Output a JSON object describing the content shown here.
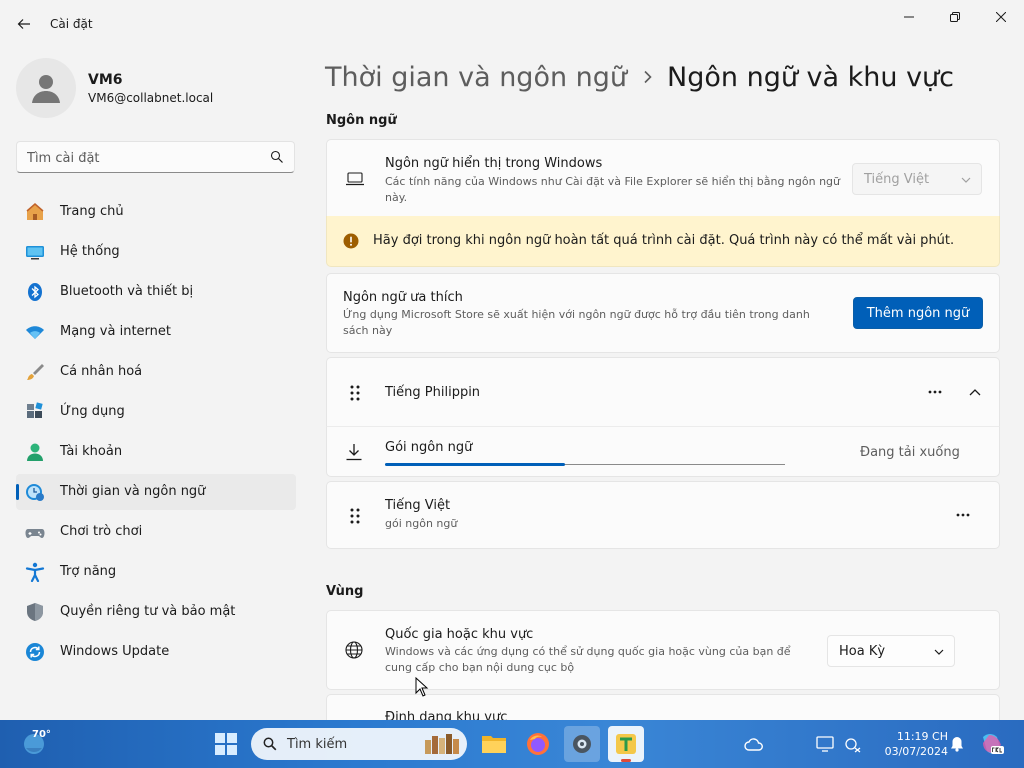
{
  "window": {
    "title": "Cài đặt"
  },
  "user": {
    "name": "VM6",
    "email": "VM6@collabnet.local"
  },
  "search": {
    "placeholder": "Tìm cài đặt"
  },
  "nav": {
    "items": [
      {
        "label": "Trang chủ",
        "icon": "home-icon"
      },
      {
        "label": "Hệ thống",
        "icon": "system-icon"
      },
      {
        "label": "Bluetooth và thiết bị",
        "icon": "bluetooth-icon"
      },
      {
        "label": "Mạng và internet",
        "icon": "wifi-icon"
      },
      {
        "label": "Cá nhân hoá",
        "icon": "brush-icon"
      },
      {
        "label": "Ứng dụng",
        "icon": "apps-icon"
      },
      {
        "label": "Tài khoản",
        "icon": "account-icon"
      },
      {
        "label": "Thời gian và ngôn ngữ",
        "icon": "time-language-icon",
        "active": true
      },
      {
        "label": "Chơi trò chơi",
        "icon": "gamepad-icon"
      },
      {
        "label": "Trợ năng",
        "icon": "accessibility-icon"
      },
      {
        "label": "Quyền riêng tư và bảo mật",
        "icon": "shield-icon"
      },
      {
        "label": "Windows Update",
        "icon": "update-icon"
      }
    ]
  },
  "breadcrumb": {
    "parent": "Thời gian và ngôn ngữ",
    "current": "Ngôn ngữ và khu vực"
  },
  "language_section": {
    "title": "Ngôn ngữ",
    "display_language": {
      "title": "Ngôn ngữ hiển thị trong Windows",
      "desc_line1": "Các tính năng của Windows như Cài đặt và File Explorer sẽ hiển thị bằng ngôn ngữ",
      "desc_line2": "này.",
      "value": "Tiếng Việt"
    },
    "warning": "Hãy đợi trong khi ngôn ngữ hoàn tất quá trình cài đặt. Quá trình này có thể mất vài phút.",
    "preferred": {
      "title": "Ngôn ngữ ưa thích",
      "desc_line1": "Ứng dụng Microsoft Store sẽ xuất hiện với ngôn ngữ được hỗ trợ đầu tiên trong danh",
      "desc_line2": "sách này",
      "add_button": "Thêm ngôn ngữ"
    },
    "languages": [
      {
        "name": "Tiếng Philippin",
        "expanded": true,
        "pack_label": "Gói ngôn ngữ",
        "pack_status": "Đang tải xuống",
        "progress": 0.45
      },
      {
        "name": "Tiếng Việt",
        "subtitle": "gói ngôn ngữ"
      }
    ]
  },
  "region_section": {
    "title": "Vùng",
    "country": {
      "title": "Quốc gia hoặc khu vực",
      "desc_line1": "Windows và các ứng dụng có thể sử dụng quốc gia hoặc vùng của bạn để",
      "desc_line2": "cung cấp cho bạn nội dung cục bộ",
      "value": "Hoa Kỳ"
    },
    "format": {
      "title": "Định dạng khu vực"
    }
  },
  "taskbar": {
    "weather_temp": "70°",
    "search_label": "Tìm kiếm",
    "time": "11:19 CH",
    "date": "03/07/2024"
  },
  "colors": {
    "accent": "#005fb8",
    "warning_bg": "#fff4ce",
    "warning_icon": "#9d5d00"
  }
}
